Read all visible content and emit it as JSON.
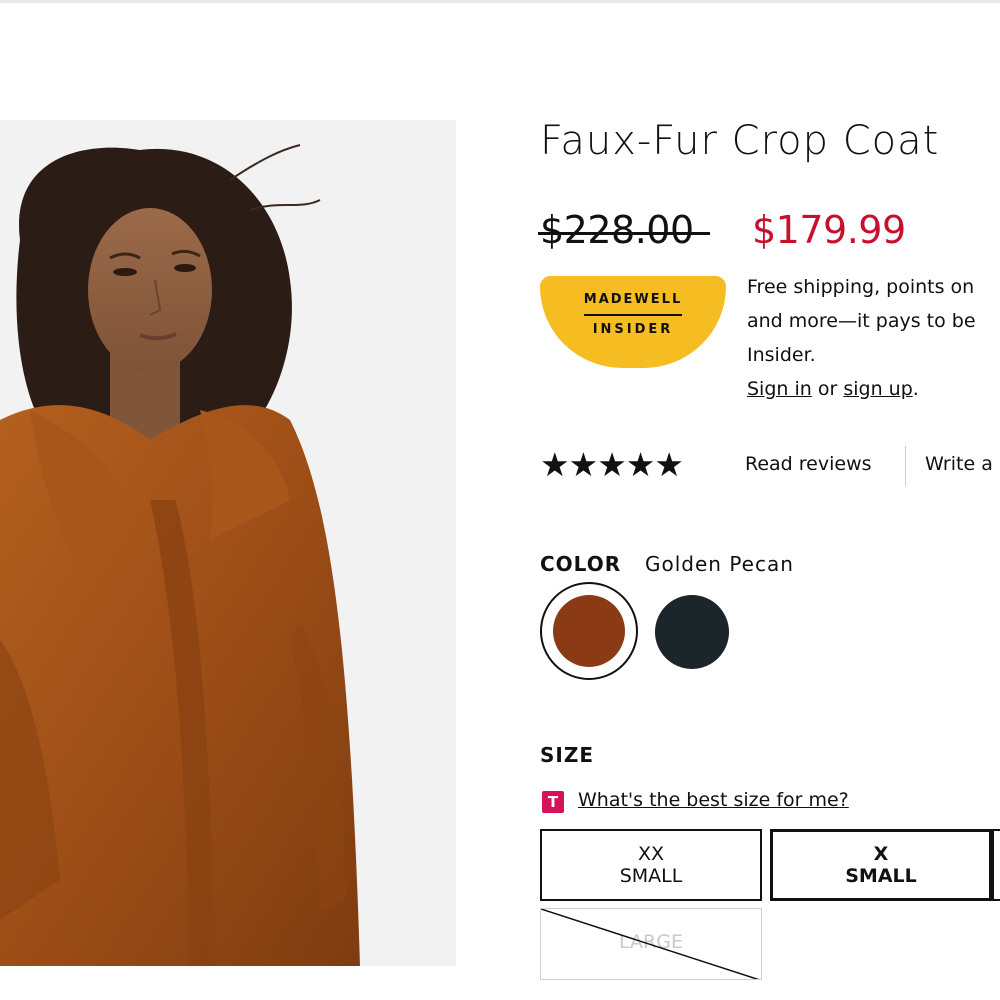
{
  "product": {
    "title": "Faux-Fur Crop Coat",
    "price_original": "$228.00",
    "price_sale": "$179.99",
    "image_icon": "product-photo"
  },
  "insider": {
    "badge_line1": "MADEWELL",
    "badge_line2": "INSIDER",
    "lines": [
      "Free shipping, points on",
      "and more—it pays to be",
      "Insider."
    ],
    "sign_in": "Sign in",
    "or": " or ",
    "sign_up": "sign up",
    "period": "."
  },
  "reviews": {
    "rating_stars": 5,
    "read_label": "Read reviews",
    "write_label": "Write a"
  },
  "color": {
    "label": "COLOR",
    "selected_name": "Golden Pecan",
    "swatches": [
      {
        "name": "Golden Pecan",
        "hex": "#8a3a14",
        "selected": true
      },
      {
        "name": "dark",
        "hex": "#1c2529",
        "selected": false
      }
    ]
  },
  "size": {
    "label": "SIZE",
    "fit_badge": "T",
    "fit_link": "What's the best size for me?",
    "options": [
      {
        "line1": "XX",
        "line2": "SMALL",
        "available": true,
        "selected": false
      },
      {
        "line1": "X",
        "line2": "SMALL",
        "available": true,
        "selected": true
      },
      {
        "line1": "LARGE",
        "line2": "",
        "available": false,
        "selected": false
      }
    ]
  },
  "colors": {
    "sale_red": "#c8102e",
    "insider_yellow": "#f5bd22",
    "fit_pink": "#d6125a"
  }
}
